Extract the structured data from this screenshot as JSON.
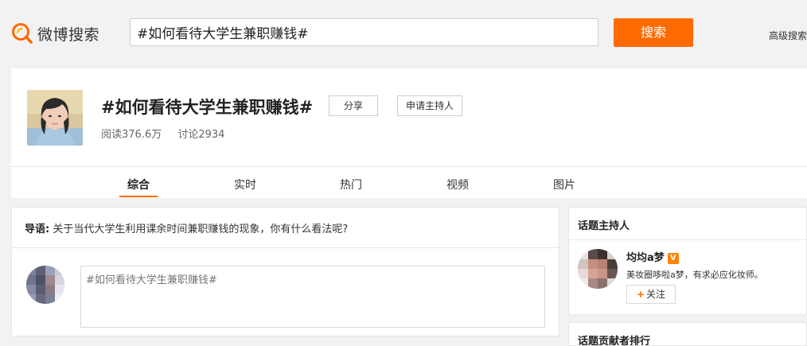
{
  "header": {
    "logo_text": "微博搜索",
    "search_value": "#如何看待大学生兼职赚钱#",
    "search_button": "搜索",
    "advanced_search": "高级搜索"
  },
  "topic": {
    "title": "#如何看待大学生兼职赚钱#",
    "share_label": "分享",
    "apply_host_label": "申请主持人",
    "reads": "阅读376.6万",
    "discussions": "讨论2934",
    "tabs": [
      {
        "label": "综合"
      },
      {
        "label": "实时"
      },
      {
        "label": "热门"
      },
      {
        "label": "视频"
      },
      {
        "label": "图片"
      }
    ]
  },
  "main": {
    "guide_label": "导语:",
    "guide_text": "关于当代大学生利用课余时间兼职赚钱的现象，你有什么看法呢?",
    "post_placeholder": "#如何看待大学生兼职赚钱#"
  },
  "sidebar": {
    "host_card_title": "话题主持人",
    "host_name": "均均a梦",
    "vip_badge": "V",
    "host_desc": "美妆圈哆啦a梦，有求必应化妆师。",
    "follow_label": "关注",
    "next_card_title": "话题贡献者排行"
  },
  "colors": {
    "accent": "#ff6a00",
    "background": "#f2f2f2",
    "vip": "#ff8200"
  }
}
